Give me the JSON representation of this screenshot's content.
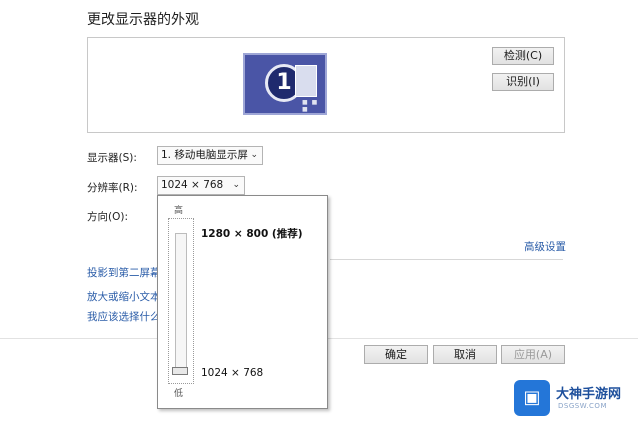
{
  "title": "更改显示器的外观",
  "preview": {
    "monitor_number": "1"
  },
  "buttons": {
    "detect": "检测(C)",
    "identify": "识别(I)",
    "ok": "确定",
    "cancel": "取消",
    "apply": "应用(A)"
  },
  "settings": {
    "display_label": "显示器(S):",
    "display_value": "1. 移动电脑显示屏",
    "resolution_label": "分辨率(R):",
    "resolution_value": "1024 × 768",
    "orientation_label": "方向(O):"
  },
  "advanced_link": "高级设置",
  "links": [
    "投影到第二屏幕",
    "放大或缩小文本",
    "我应该选择什么"
  ],
  "resolution_dropdown": {
    "high_label": "高",
    "low_label": "低",
    "options": [
      {
        "label": "1280 × 800 (推荐)"
      },
      {
        "label": "1024 × 768"
      }
    ],
    "selected_index": 1
  },
  "watermark": {
    "text": "大神手游网",
    "sub": "DSGSW.COM"
  },
  "colors": {
    "link": "#2a5ca8",
    "monitor": "#4a55a6",
    "watermark_blue": "#2476d8"
  }
}
